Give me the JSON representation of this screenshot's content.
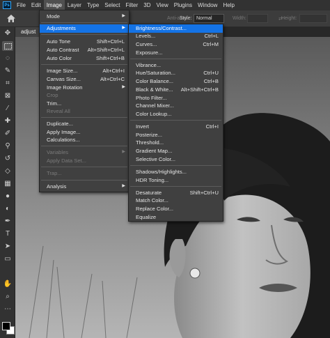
{
  "menubar": {
    "logo": "Ps",
    "items": [
      "File",
      "Edit",
      "Image",
      "Layer",
      "Type",
      "Select",
      "Filter",
      "3D",
      "View",
      "Plugins",
      "Window",
      "Help"
    ]
  },
  "options": {
    "antialias": "Anti-alias",
    "style_label": "Style:",
    "style_value": "Normal",
    "width_label": "Width:",
    "height_label": "Height:"
  },
  "document": {
    "tab_label": "adjust"
  },
  "image_menu": {
    "items": [
      {
        "label": "Mode",
        "arrow": true
      },
      {
        "label": "Adjustments",
        "arrow": true,
        "highlight": true
      },
      {
        "label": "Auto Tone",
        "shortcut": "Shift+Ctrl+L"
      },
      {
        "label": "Auto Contrast",
        "shortcut": "Alt+Shift+Ctrl+L"
      },
      {
        "label": "Auto Color",
        "shortcut": "Shift+Ctrl+B"
      },
      {
        "label": "Image Size...",
        "shortcut": "Alt+Ctrl+I"
      },
      {
        "label": "Canvas Size...",
        "shortcut": "Alt+Ctrl+C"
      },
      {
        "label": "Image Rotation",
        "arrow": true
      },
      {
        "label": "Crop",
        "disabled": true
      },
      {
        "label": "Trim..."
      },
      {
        "label": "Reveal All",
        "disabled": true
      },
      {
        "label": "Duplicate..."
      },
      {
        "label": "Apply Image..."
      },
      {
        "label": "Calculations..."
      },
      {
        "label": "Variables",
        "arrow": true,
        "disabled": true
      },
      {
        "label": "Apply Data Set...",
        "disabled": true
      },
      {
        "label": "Trap...",
        "disabled": true
      },
      {
        "label": "Analysis",
        "arrow": true
      }
    ]
  },
  "adjust_menu": {
    "items": [
      {
        "label": "Brightness/Contrast...",
        "highlight": true
      },
      {
        "label": "Levels...",
        "shortcut": "Ctrl+L"
      },
      {
        "label": "Curves...",
        "shortcut": "Ctrl+M"
      },
      {
        "label": "Exposure..."
      },
      {
        "label": "Vibrance..."
      },
      {
        "label": "Hue/Saturation...",
        "shortcut": "Ctrl+U"
      },
      {
        "label": "Color Balance...",
        "shortcut": "Ctrl+B"
      },
      {
        "label": "Black & White...",
        "shortcut": "Alt+Shift+Ctrl+B"
      },
      {
        "label": "Photo Filter..."
      },
      {
        "label": "Channel Mixer..."
      },
      {
        "label": "Color Lookup..."
      },
      {
        "label": "Invert",
        "shortcut": "Ctrl+I"
      },
      {
        "label": "Posterize..."
      },
      {
        "label": "Threshold..."
      },
      {
        "label": "Gradient Map..."
      },
      {
        "label": "Selective Color..."
      },
      {
        "label": "Shadows/Highlights..."
      },
      {
        "label": "HDR Toning..."
      },
      {
        "label": "Desaturate",
        "shortcut": "Shift+Ctrl+U"
      },
      {
        "label": "Match Color..."
      },
      {
        "label": "Replace Color..."
      },
      {
        "label": "Equalize"
      }
    ]
  },
  "toolbar": {
    "tools": [
      "move-tool",
      "marquee-tool",
      "lasso-tool",
      "quick-select-tool",
      "crop-tool",
      "frame-tool",
      "eyedropper-tool",
      "healing-brush-tool",
      "brush-tool",
      "clone-stamp-tool",
      "history-brush-tool",
      "eraser-tool",
      "gradient-tool",
      "blur-tool",
      "dodge-tool",
      "pen-tool",
      "type-tool",
      "path-select-tool",
      "rectangle-tool",
      "hand-tool",
      "zoom-tool"
    ],
    "foreground_color": "#000000",
    "background_color": "#ffffff"
  },
  "colors": {
    "accent": "#1473e6",
    "menu_bg": "#404040",
    "chrome": "#323232"
  }
}
